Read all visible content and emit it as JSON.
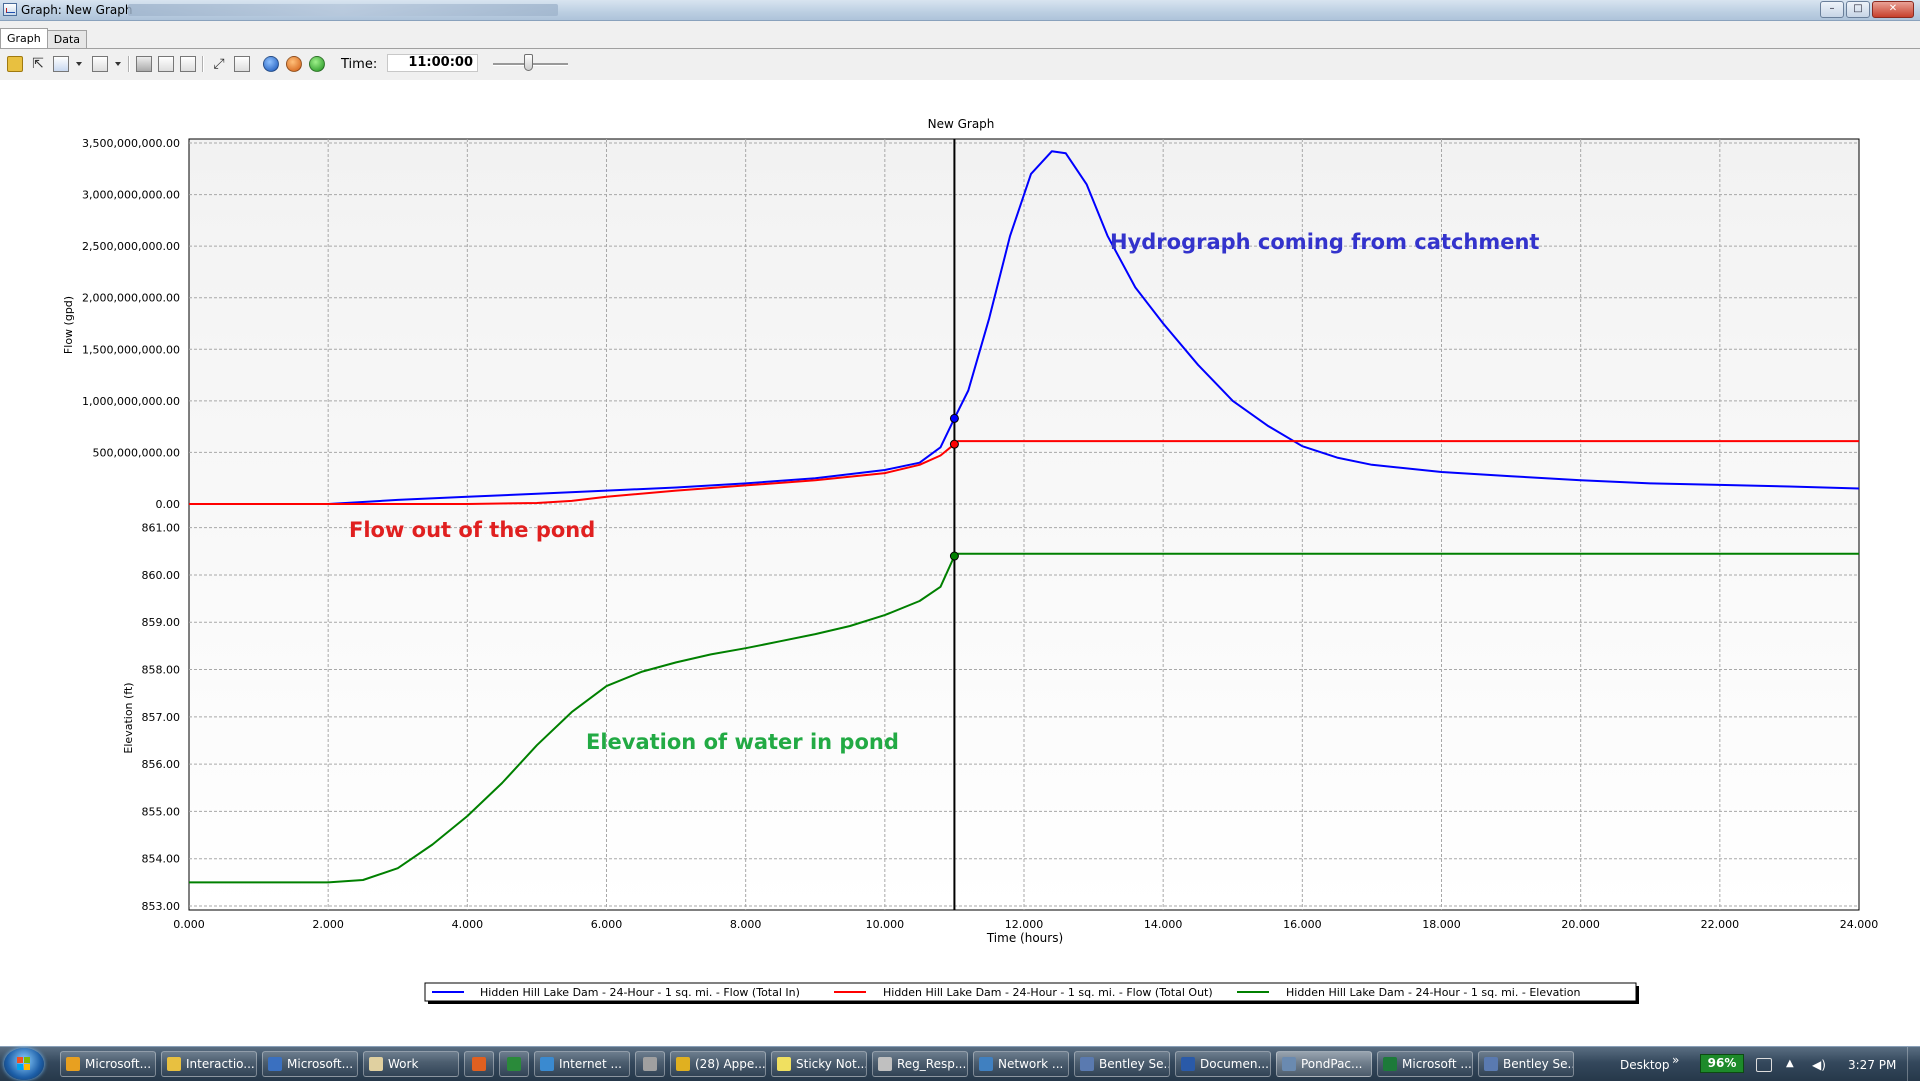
{
  "window": {
    "title": "Graph: New Graph",
    "buttons": {
      "minimize": "–",
      "maximize": "□",
      "close": "✕"
    }
  },
  "tabs": [
    {
      "label": "Graph",
      "active": true
    },
    {
      "label": "Data",
      "active": false
    }
  ],
  "toolbar": {
    "time_label": "Time:",
    "time_value": "11:00:00",
    "icons": [
      "new-graph-icon",
      "select-series-icon",
      "chart-options-icon",
      "table-options-icon",
      "print-icon",
      "print-preview-icon",
      "copy-icon",
      "zoom-icon",
      "zoom-extents-icon",
      "rewind-icon",
      "pause-icon",
      "play-icon"
    ],
    "slider_level": 0.45
  },
  "chart_data": {
    "type": "line",
    "title": "New Graph",
    "xlabel": "Time (hours)",
    "xlim": [
      0,
      24
    ],
    "x_ticks": [
      "0.000",
      "2.000",
      "4.000",
      "6.000",
      "8.000",
      "10.000",
      "12.000",
      "14.000",
      "16.000",
      "18.000",
      "20.000",
      "22.000",
      "24.000"
    ],
    "grid": true,
    "current_time": 11.0,
    "panels": [
      {
        "ylabel": "Flow (gpd)",
        "ylim": [
          0,
          3500000000
        ],
        "y_ticks": [
          "0.00",
          "500,000,000.00",
          "1,000,000,000.00",
          "1,500,000,000.00",
          "2,000,000,000.00",
          "2,500,000,000.00",
          "3,000,000,000.00",
          "3,500,000,000.00"
        ],
        "series": [
          {
            "name": "Hidden Hill Lake Dam - 24-Hour - 1 sq. mi. - Flow (Total In)",
            "color": "#0000ff",
            "points": [
              [
                0,
                0
              ],
              [
                2,
                0
              ],
              [
                3,
                40000000
              ],
              [
                4,
                70000000
              ],
              [
                5,
                100000000
              ],
              [
                6,
                130000000
              ],
              [
                7,
                160000000
              ],
              [
                8,
                200000000
              ],
              [
                9,
                250000000
              ],
              [
                10,
                330000000
              ],
              [
                10.5,
                400000000
              ],
              [
                10.8,
                550000000
              ],
              [
                11,
                830000000
              ],
              [
                11.2,
                1100000000
              ],
              [
                11.5,
                1800000000
              ],
              [
                11.8,
                2600000000
              ],
              [
                12.1,
                3200000000
              ],
              [
                12.4,
                3420000000
              ],
              [
                12.6,
                3400000000
              ],
              [
                12.9,
                3100000000
              ],
              [
                13.2,
                2600000000
              ],
              [
                13.6,
                2100000000
              ],
              [
                14,
                1750000000
              ],
              [
                14.5,
                1350000000
              ],
              [
                15,
                1000000000
              ],
              [
                15.5,
                760000000
              ],
              [
                16,
                560000000
              ],
              [
                16.5,
                450000000
              ],
              [
                17,
                380000000
              ],
              [
                18,
                310000000
              ],
              [
                19,
                270000000
              ],
              [
                20,
                230000000
              ],
              [
                21,
                200000000
              ],
              [
                22,
                185000000
              ],
              [
                23,
                170000000
              ],
              [
                24,
                150000000
              ]
            ]
          },
          {
            "name": "Hidden Hill Lake Dam - 24-Hour - 1 sq. mi. - Flow (Total Out)",
            "color": "#ff0000",
            "points": [
              [
                0,
                0
              ],
              [
                4,
                0
              ],
              [
                5,
                10000000
              ],
              [
                5.5,
                30000000
              ],
              [
                6,
                70000000
              ],
              [
                7,
                130000000
              ],
              [
                8,
                180000000
              ],
              [
                9,
                230000000
              ],
              [
                10,
                300000000
              ],
              [
                10.5,
                380000000
              ],
              [
                10.8,
                470000000
              ],
              [
                11,
                580000000
              ],
              [
                11.05,
                610000000
              ],
              [
                24,
                610000000
              ]
            ]
          }
        ]
      },
      {
        "ylabel": "Elevation (ft)",
        "ylim": [
          853,
          861.5
        ],
        "y_ticks": [
          "853.00",
          "854.00",
          "855.00",
          "856.00",
          "857.00",
          "858.00",
          "859.00",
          "860.00",
          "861.00"
        ],
        "series": [
          {
            "name": "Hidden Hill Lake Dam - 24-Hour - 1 sq. mi. - Elevation",
            "color": "#008000",
            "points": [
              [
                0,
                853.5
              ],
              [
                2,
                853.5
              ],
              [
                2.5,
                853.55
              ],
              [
                3,
                853.8
              ],
              [
                3.5,
                854.3
              ],
              [
                4,
                854.9
              ],
              [
                4.5,
                855.6
              ],
              [
                5,
                856.4
              ],
              [
                5.5,
                857.1
              ],
              [
                6,
                857.65
              ],
              [
                6.5,
                857.95
              ],
              [
                7,
                858.15
              ],
              [
                7.5,
                858.32
              ],
              [
                8,
                858.45
              ],
              [
                8.5,
                858.6
              ],
              [
                9,
                858.75
              ],
              [
                9.5,
                858.92
              ],
              [
                10,
                859.15
              ],
              [
                10.5,
                859.45
              ],
              [
                10.8,
                859.75
              ],
              [
                11,
                860.4
              ],
              [
                11.05,
                860.45
              ],
              [
                24,
                860.45
              ]
            ]
          }
        ]
      }
    ],
    "annotations": [
      {
        "text": "Hydrograph coming from catchment",
        "color": "#3333cc"
      },
      {
        "text": "Flow out of the pond",
        "color": "#e02020"
      },
      {
        "text": "Elevation of water in pond",
        "color": "#22aa44"
      }
    ],
    "legend_position": "bottom"
  },
  "taskbar": {
    "items": [
      {
        "label": "Microsoft...",
        "color": "#e8a020"
      },
      {
        "label": "Interactio...",
        "color": "#e8c040"
      },
      {
        "label": "Microsoft...",
        "color": "#3a70c0"
      },
      {
        "label": "Work",
        "color": "#e0d0a0"
      },
      {
        "label": "",
        "color": "#e06020"
      },
      {
        "label": "",
        "color": "#2a8a3a"
      },
      {
        "label": "Internet ...",
        "color": "#3a8ad0"
      },
      {
        "label": "",
        "color": "#a0a0a0"
      },
      {
        "label": "(28) Appe...",
        "color": "#e0b020"
      },
      {
        "label": "Sticky Not...",
        "color": "#f0e060"
      },
      {
        "label": "Reg_Resp...",
        "color": "#c0c0c0"
      },
      {
        "label": "Network ...",
        "color": "#4080c0"
      },
      {
        "label": "Bentley Se...",
        "color": "#5a7ab0"
      },
      {
        "label": "Documen...",
        "color": "#2a5aa8"
      },
      {
        "label": "PondPac...",
        "color": "#6a8ab0"
      },
      {
        "label": "Microsoft ...",
        "color": "#1d7a3a"
      },
      {
        "label": "Bentley Se...",
        "color": "#5a7ab0"
      }
    ],
    "desktop_label": "Desktop",
    "chevron": "»",
    "battery": "96%",
    "clock": "3:27 PM"
  }
}
